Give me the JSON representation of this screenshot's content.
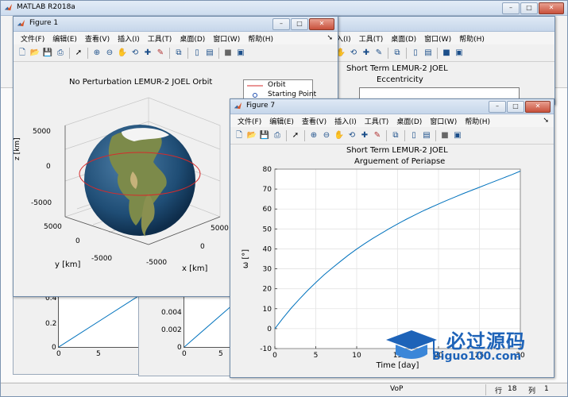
{
  "main_title": "MATLAB R2018a",
  "status_bar": {
    "mode": "VoP",
    "row_label": "行",
    "row_value": "18",
    "col_label": "列",
    "col_value": "1"
  },
  "watermark": {
    "cn": "必过源码",
    "en": "Biguo100.com"
  },
  "bg_right_fig": {
    "menu": [
      "入(I)",
      "工具(T)",
      "桌面(D)",
      "窗口(W)",
      "帮助(H)"
    ],
    "title1": "Short Term LEMUR-2 JOEL",
    "title2": "Eccentricity"
  },
  "bg_bottom_left": {
    "ticks_y": [
      "0.4",
      "0.2",
      "0"
    ],
    "ticks_x": [
      "0",
      "5"
    ]
  },
  "bg_bottom_mid": {
    "ticks_y": [
      "0.004",
      "0.002",
      "0"
    ],
    "ticks_x": [
      "0",
      "5"
    ]
  },
  "figure1": {
    "title": "Figure 1",
    "menu": [
      "文件(F)",
      "编辑(E)",
      "查看(V)",
      "插入(I)",
      "工具(T)",
      "桌面(D)",
      "窗口(W)",
      "帮助(H)"
    ],
    "plot_title": "No Perturbation LEMUR-2 JOEL Orbit",
    "legend": [
      "Orbit",
      "Starting Point"
    ],
    "zlabel": "z [km]",
    "ylabel": "y [km]",
    "xlabel": "x [km]",
    "z_ticks": [
      "5000",
      "0",
      "-5000"
    ],
    "y_ticks": [
      "5000",
      "0",
      "-5000"
    ],
    "x_ticks": [
      "-5000",
      "0",
      "5000"
    ]
  },
  "figure7": {
    "title": "Figure 7",
    "menu": [
      "文件(F)",
      "编辑(E)",
      "查看(V)",
      "插入(I)",
      "工具(T)",
      "桌面(D)",
      "窗口(W)",
      "帮助(H)"
    ],
    "plot_title1": "Short Term LEMUR-2 JOEL",
    "plot_title2": "Arguement of Periapse"
  },
  "chart_data": {
    "type": "line",
    "title": "Short Term LEMUR-2 JOEL Arguement of Periapse",
    "xlabel": "Time [day]",
    "ylabel": "ω [°]",
    "xlim": [
      0,
      30
    ],
    "ylim": [
      -10,
      80
    ],
    "x_ticks": [
      0,
      5,
      10,
      15,
      20,
      25,
      30
    ],
    "y_ticks": [
      -10,
      0,
      10,
      20,
      30,
      40,
      50,
      60,
      70,
      80
    ],
    "grid": true,
    "series": [
      {
        "color": "#0072bd",
        "x": [
          0,
          1,
          2,
          3,
          4,
          5,
          6,
          7,
          8,
          9,
          10,
          11,
          12,
          13,
          14,
          15,
          16,
          17,
          18,
          19,
          20,
          21,
          22,
          23,
          24,
          25,
          26,
          27,
          28,
          29,
          30
        ],
        "y": [
          0,
          5.3,
          10.3,
          14.8,
          19.1,
          23.1,
          26.9,
          30.4,
          33.7,
          36.9,
          39.9,
          42.7,
          45.3,
          47.8,
          50.2,
          52.5,
          54.7,
          56.8,
          58.8,
          60.7,
          62.5,
          64.3,
          66.0,
          67.7,
          69.3,
          70.9,
          72.5,
          74.1,
          75.7,
          77.3,
          79
        ]
      }
    ]
  }
}
